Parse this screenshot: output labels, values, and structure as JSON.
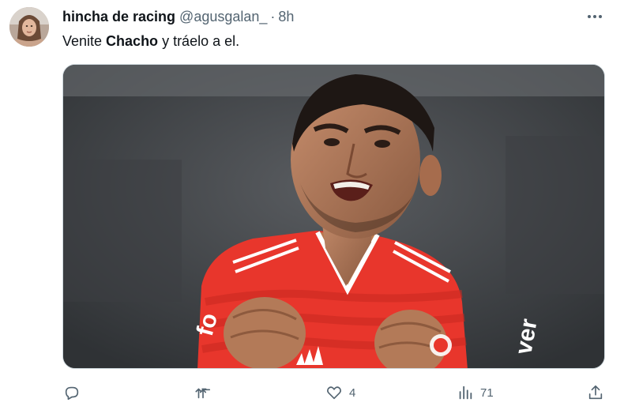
{
  "tweet": {
    "author": {
      "display_name": "hincha de racing",
      "handle": "@agusgalan_",
      "separator": "·",
      "time": "8h"
    },
    "text": {
      "before": "Venite ",
      "bold": "Chacho",
      "after": " y tráelo a el."
    },
    "media": {
      "jersey_text_left": "fo",
      "jersey_text_right": "ver"
    },
    "actions": {
      "reply_count": "",
      "retweet_count": "",
      "like_count": "4",
      "views_count": "71"
    }
  },
  "colors": {
    "text_primary": "#0f1419",
    "text_secondary": "#536471",
    "jersey_red": "#e8362c"
  },
  "icons": [
    "more-icon",
    "reply-icon",
    "retweet-icon",
    "like-icon",
    "views-icon",
    "share-icon"
  ]
}
